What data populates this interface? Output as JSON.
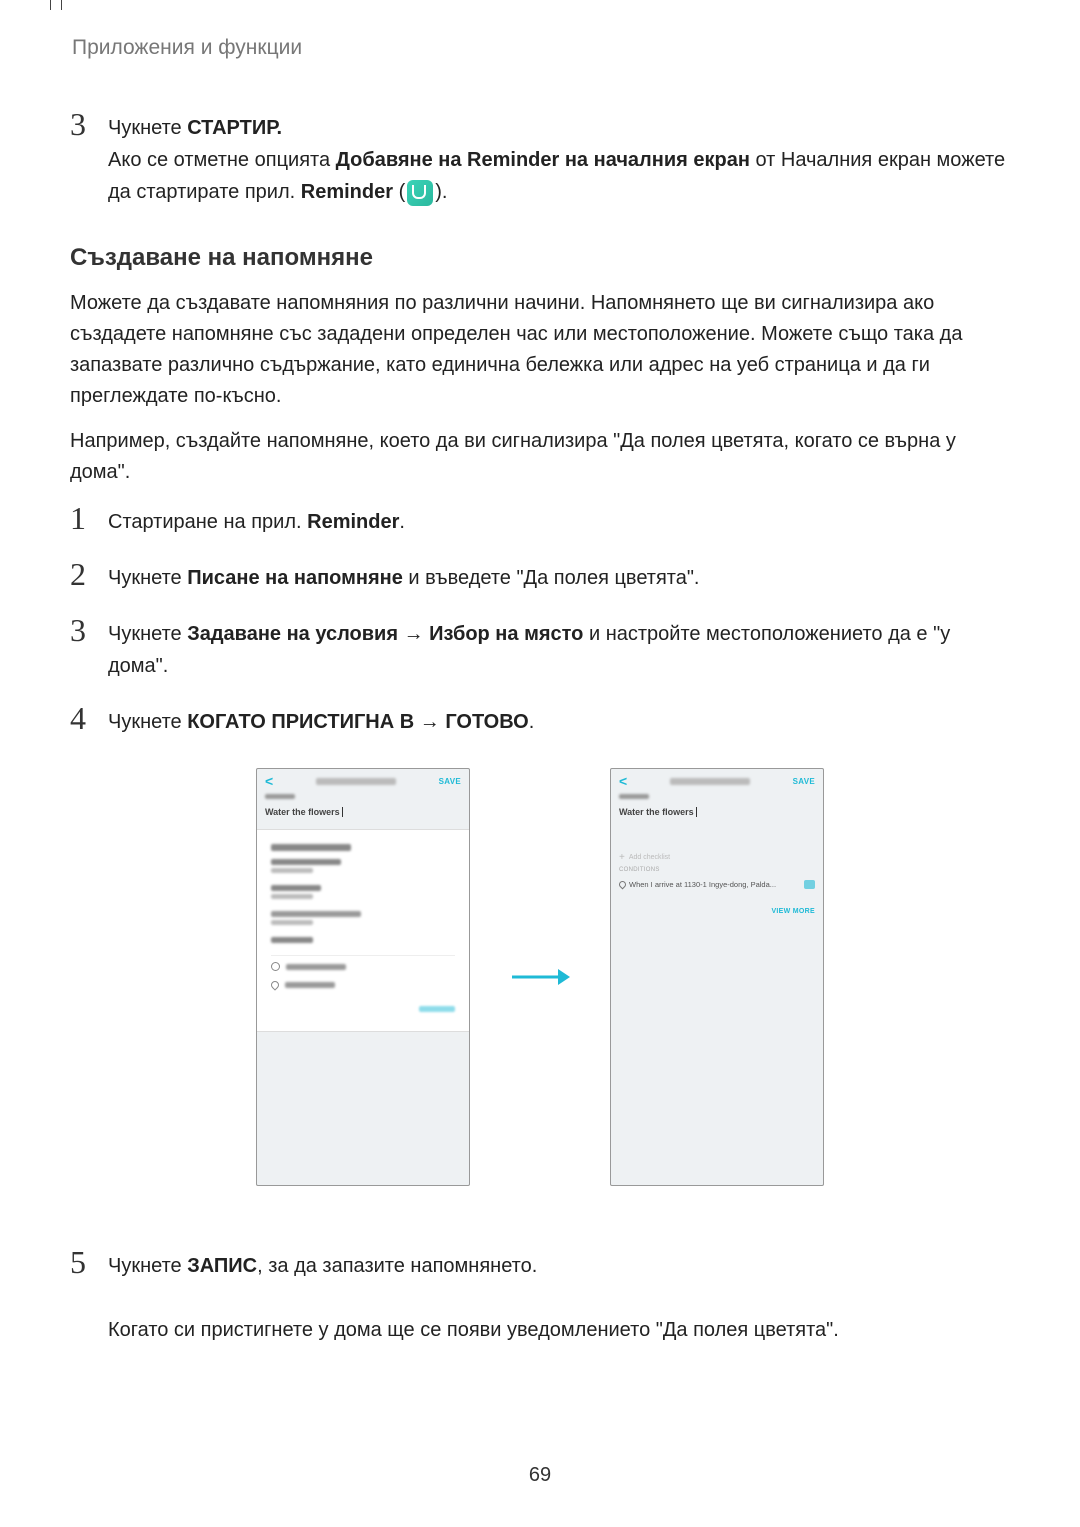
{
  "header": "Приложения и функции",
  "step3": {
    "num": "3",
    "pre": "Чукнете ",
    "bold1": "СТАРТИР.",
    "line2_pre": "Ако се отметне опцията ",
    "line2_bold": "Добавяне на Reminder на началния екран",
    "line2_post": " от Началния екран можете да стартирате прил. ",
    "line2_bold2": "Reminder",
    "line2_end": " (",
    "line2_close": ")."
  },
  "section_title": "Създаване на напомняне",
  "para1": "Можете да създавате напомняния по различни начини. Напомнянето ще ви сигнализира ако създадете напомняне със зададени определен час или местоположение. Можете също така да запазвате различно съдържание, като единична бележка или адрес на уеб страница и да ги преглеждате по-късно.",
  "para2": "Например, създайте напомняне, което да ви сигнализира \"Да полея цветята, когато се върна у дома\".",
  "step1": {
    "num": "1",
    "pre": "Стартиране на прил. ",
    "bold": "Reminder",
    "post": "."
  },
  "step2": {
    "num": "2",
    "pre": "Чукнете ",
    "bold": "Писане на напомняне",
    "post": " и въведете \"Да полея цветята\"."
  },
  "step3b": {
    "num": "3",
    "pre": "Чукнете ",
    "bold1": "Задаване на условия",
    "arrow": " → ",
    "bold2": "Избор на място",
    "post": " и настройте местоположението да е \"у дома\"."
  },
  "step4": {
    "num": "4",
    "pre": "Чукнете ",
    "bold1": "КОГАТО ПРИСТИГНА В",
    "arrow": " → ",
    "bold2": "ГОТОВО",
    "post": "."
  },
  "step5": {
    "num": "5",
    "pre": "Чукнете ",
    "bold": "ЗАПИС",
    "post": ", за да запазите напомнянето.",
    "line2": "Когато си пристигнете у дома ще се появи уведомлението \"Да полея цветята\"."
  },
  "phone1": {
    "save": "SAVE",
    "input": "Water the flowers"
  },
  "phone2": {
    "save": "SAVE",
    "input": "Water the flowers",
    "add_checklist": "Add checklist",
    "conditions": "CONDITIONS",
    "cond_text": "When I arrive at 1130-1 Ingye-dong, Palda...",
    "view_more": "VIEW MORE"
  },
  "page_number": "69"
}
